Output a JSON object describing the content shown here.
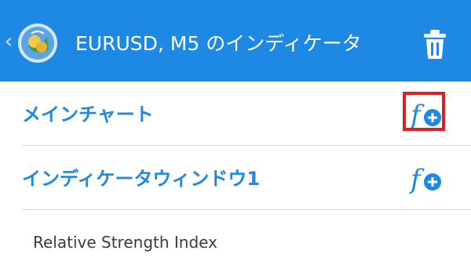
{
  "header": {
    "back_icon": "chevron-left-icon",
    "logo_icon": "metatrader-logo-icon",
    "title": "EURUSD, M5 のインディケータ",
    "trash_icon": "trash-icon",
    "background_color": "#1e88e5"
  },
  "sections": [
    {
      "label": "メインチャート",
      "action_icon": "add-function-icon"
    },
    {
      "label": "インディケータウィンドウ1",
      "action_icon": "add-function-icon"
    }
  ],
  "indicators": [
    {
      "label": "Relative Strength Index"
    }
  ],
  "colors": {
    "accent": "#1e88e5",
    "highlight": "#e02020",
    "divider": "#d9d9d9",
    "text": "#3c3c3c"
  }
}
